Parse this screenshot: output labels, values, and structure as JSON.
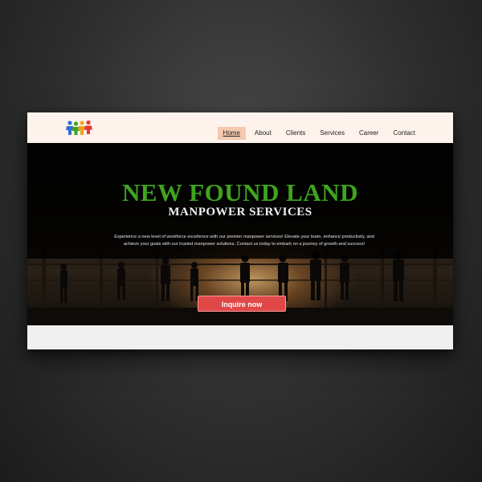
{
  "navbar": {
    "logo_icon": "puzzle-people-logo-icon",
    "links": [
      "Home",
      "About",
      "Clients",
      "Services",
      "Career",
      "Contact"
    ],
    "active_link": "Home"
  },
  "hero": {
    "title": "NEW FOUND LAND",
    "subtitle": "MANPOWER SERVICES",
    "description": "Experience a new level of workforce excellence with our premier manpower services! Elevate your team, enhance productivity, and achieve your goals with our trusted manpower solutions. Contact us today to embark on a journey of growth and success!",
    "cta_label": "Inquire now",
    "background_image": "construction-workers-silhouette-image"
  },
  "colors": {
    "title_green": "#3fa51f",
    "cta_red": "#e04848",
    "navbar_bg": "#fdf3ec",
    "active_link_bg": "#f3c9b0"
  }
}
